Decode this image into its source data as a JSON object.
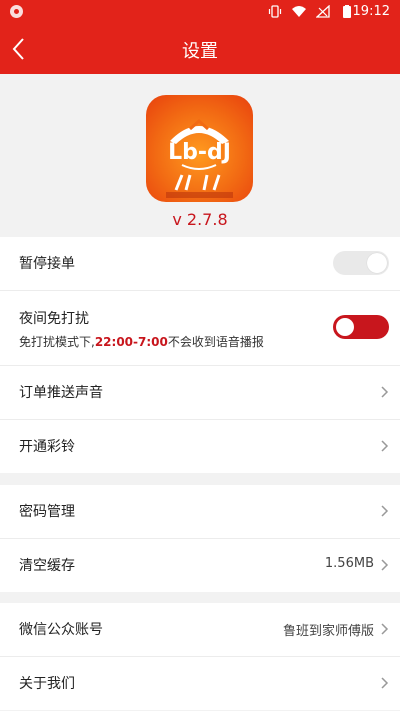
{
  "status_bar": {
    "time": "19:12"
  },
  "nav": {
    "title": "设置"
  },
  "app": {
    "version": "v 2.7.8",
    "logo_text": "Lb-dJ"
  },
  "settings": {
    "pause_orders": {
      "label": "暂停接单",
      "enabled": false
    },
    "night_dnd": {
      "label": "夜间免打扰",
      "sub_prefix": "免打扰模式下,",
      "sub_time": "22:00-7:00",
      "sub_suffix": "不会收到语音播报",
      "enabled": true
    },
    "order_push_sound": {
      "label": "订单推送声音"
    },
    "ringback": {
      "label": "开通彩铃"
    },
    "password": {
      "label": "密码管理"
    },
    "clear_cache": {
      "label": "清空缓存",
      "value": "1.56MB"
    },
    "wechat": {
      "label": "微信公众账号",
      "value": "鲁班到家师傅版"
    },
    "about": {
      "label": "关于我们"
    }
  },
  "colors": {
    "brand": "#e2231a",
    "accent": "#c8161d"
  }
}
